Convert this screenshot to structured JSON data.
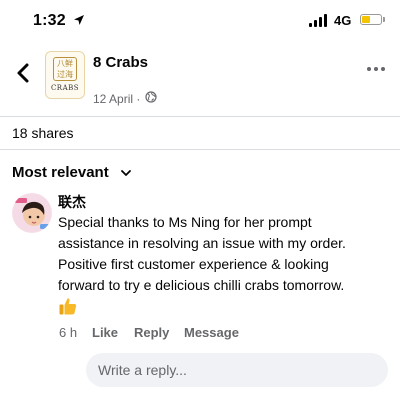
{
  "status_bar": {
    "time": "1:32",
    "network": "4G",
    "battery_level": 0.4,
    "battery_color": "#f5c400"
  },
  "header": {
    "page_name": "8 Crabs",
    "post_date": "12 April ·",
    "avatar_glyphs": "八鲜过海",
    "avatar_word": "CRABS",
    "back_icon": "chevron-left-icon",
    "more_icon": "more-horizontal-icon",
    "privacy_icon": "globe-icon"
  },
  "shares": {
    "label": "18 shares"
  },
  "sort": {
    "label": "Most relevant",
    "icon": "chevron-down-icon"
  },
  "comment": {
    "author": "联杰",
    "text": "Special thanks to Ms Ning for her prompt assistance in resolving an issue with my order. Positive first customer experience & looking forward to try e delicious chilli crabs tomorrow.",
    "reaction_icon": "thumbs-up-icon",
    "time": "6 h",
    "like_label": "Like",
    "reply_label": "Reply",
    "message_label": "Message"
  },
  "reply_box": {
    "placeholder": "Write a reply..."
  },
  "colors": {
    "secondary_text": "#65676b",
    "divider": "#dadde1",
    "input_bg": "#f0f2f5",
    "like_yellow": "#f7b928"
  }
}
